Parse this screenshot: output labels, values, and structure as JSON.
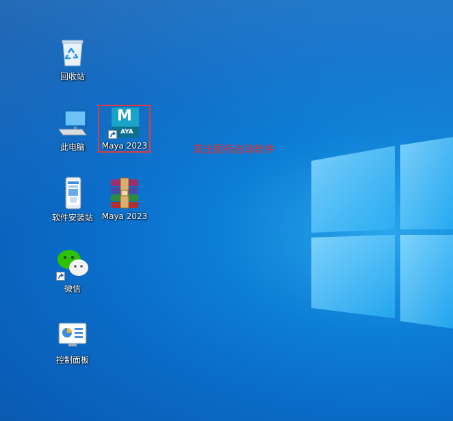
{
  "desktop": {
    "icons": [
      {
        "name": "recycle-bin",
        "label": "回收站",
        "icon": "recycle-bin-icon"
      },
      {
        "name": "this-pc",
        "label": "此电脑",
        "icon": "computer-icon"
      },
      {
        "name": "maya-shortcut",
        "label": "Maya 2023",
        "icon": "maya-icon",
        "badge_text": "AYA",
        "glyph": "M"
      },
      {
        "name": "software-installer",
        "label": "软件安装站",
        "icon": "phone-app-icon"
      },
      {
        "name": "maya-archive",
        "label": "Maya 2023",
        "icon": "winrar-archive-icon"
      },
      {
        "name": "wechat",
        "label": "微信",
        "icon": "wechat-icon"
      },
      {
        "name": "control-panel",
        "label": "控制面板",
        "icon": "control-panel-icon"
      }
    ],
    "annotation": "双击图标启动软件",
    "highlight_color": "#e23b3b"
  }
}
